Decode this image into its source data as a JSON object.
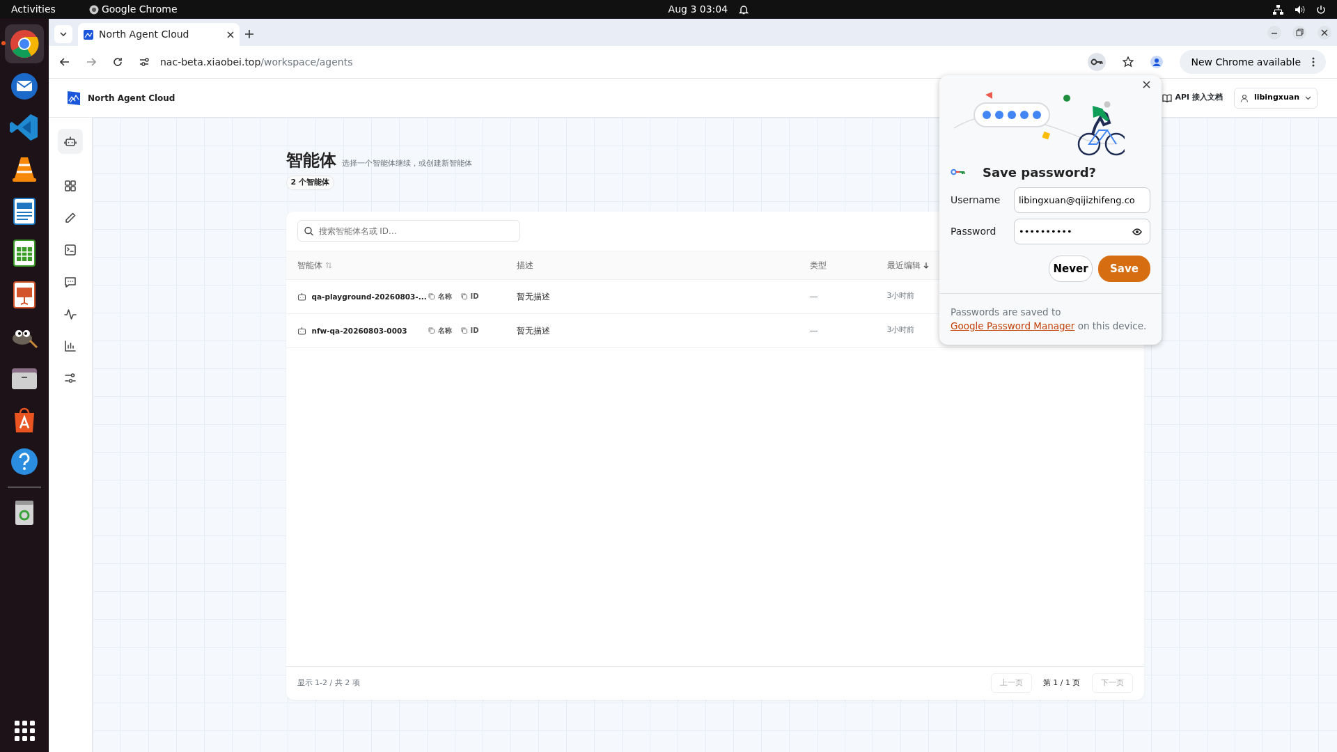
{
  "system_bar": {
    "activities": "Activities",
    "app_name": "Google Chrome",
    "clock": "Aug 3  03:04"
  },
  "dock": [
    {
      "kind": "chrome",
      "selected": true
    },
    {
      "kind": "thunderbird",
      "selected": false
    },
    {
      "kind": "vscode",
      "selected": false
    },
    {
      "kind": "vlc",
      "selected": false
    },
    {
      "kind": "writer",
      "selected": false
    },
    {
      "kind": "calc",
      "selected": false
    },
    {
      "kind": "impress",
      "selected": false
    },
    {
      "kind": "gimp",
      "selected": false
    },
    {
      "kind": "files",
      "selected": false
    },
    {
      "kind": "appstore",
      "selected": false
    },
    {
      "kind": "help",
      "selected": false
    },
    {
      "kind": "trash",
      "selected": false
    }
  ],
  "browser": {
    "tab_title": "North Agent Cloud",
    "url_host": "nac-beta.xiaobei.top",
    "url_path": "/workspace/agents",
    "update_button": "New Chrome available"
  },
  "app": {
    "brand": "North Agent Cloud",
    "api_docs": "API 接入文档",
    "user": "libingxuan",
    "nav": [
      {
        "kind": "robot",
        "selected": true
      },
      {
        "kind": "grid",
        "selected": false
      },
      {
        "kind": "pencil",
        "selected": false
      },
      {
        "kind": "terminal",
        "selected": false
      },
      {
        "kind": "chat",
        "selected": false
      },
      {
        "kind": "pulse",
        "selected": false
      },
      {
        "kind": "chart",
        "selected": false
      },
      {
        "kind": "sliders",
        "selected": false
      }
    ]
  },
  "page": {
    "title": "智能体",
    "subtitle": "选择一个智能体继续，或创建新智能体",
    "count_badge": "2 个智能体",
    "search_placeholder": "搜索智能体名或 ID...",
    "columns": [
      {
        "label": "智能体",
        "sortable": true,
        "sorted": false
      },
      {
        "label": "描述",
        "sortable": false
      },
      {
        "label": "类型",
        "sortable": false
      },
      {
        "label": "最近编辑",
        "sortable": true,
        "sorted": true
      }
    ],
    "rows": [
      {
        "name": "qa-playground-20260803-...",
        "copy_name": "名称",
        "copy_id": "ID",
        "description": "暂无描述",
        "type": "—",
        "edited": "3小时前"
      },
      {
        "name": "nfw-qa-20260803-0003",
        "copy_name": "名称",
        "copy_id": "ID",
        "description": "暂无描述",
        "type": "—",
        "edited": "3小时前"
      }
    ],
    "footer": {
      "summary": "显示 1-2 / 共 2 项",
      "prev": "上一页",
      "prev_disabled": true,
      "page": "第 1 / 1 页",
      "next": "下一页",
      "next_disabled": true
    }
  },
  "password_prompt": {
    "title": "Save password?",
    "username_label": "Username",
    "username": "libingxuan@qijizhifeng.co",
    "password_label": "Password",
    "password": "••••••••••",
    "never": "Never",
    "save": "Save",
    "note_before": "Passwords are saved to",
    "note_link": "Google Password Manager",
    "note_after": "on this device."
  }
}
